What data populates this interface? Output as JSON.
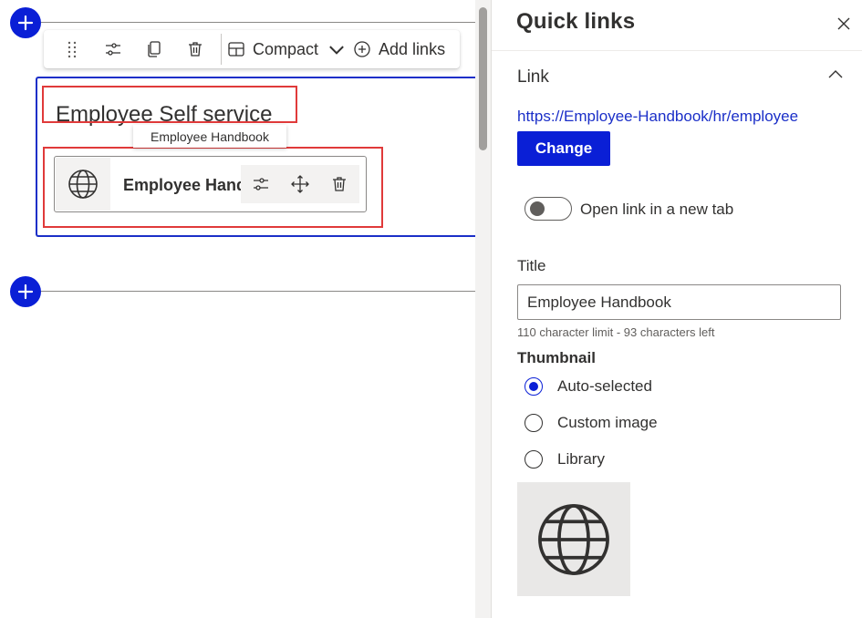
{
  "toolbar": {
    "layout_label": "Compact",
    "add_links_label": "Add links",
    "icons": [
      "drag-handle-icon",
      "settings-sliders-icon",
      "duplicate-icon",
      "delete-icon",
      "layout-icon",
      "chevron-down-icon",
      "add-circle-icon"
    ]
  },
  "webpart": {
    "title": "Employee Self service",
    "tooltip": "Employee Handbook",
    "link_card": {
      "name": "Employee Handbook",
      "icon": "globe-icon",
      "action_icons": [
        "edit-sliders-icon",
        "move-icon",
        "delete-icon"
      ]
    }
  },
  "pane": {
    "title": "Quick links",
    "link_section": {
      "label": "Link",
      "url": "https://Employee-Handbook/hr/employee",
      "change_label": "Change",
      "toggle_label": "Open link in a new tab",
      "toggle_on": false
    },
    "title_field": {
      "label": "Title",
      "value": "Employee Handbook",
      "hint": "110 character limit - 93 characters left"
    },
    "thumbnail": {
      "label": "Thumbnail",
      "options": [
        "Auto-selected",
        "Custom image",
        "Library"
      ],
      "selected": "Auto-selected",
      "preview_icon": "globe-icon"
    }
  },
  "colors": {
    "accent": "#0a1fd6",
    "link": "#1b2fc8",
    "highlight_box": "#e03a3a",
    "thumbnail_bg": "#e9e8e7"
  }
}
